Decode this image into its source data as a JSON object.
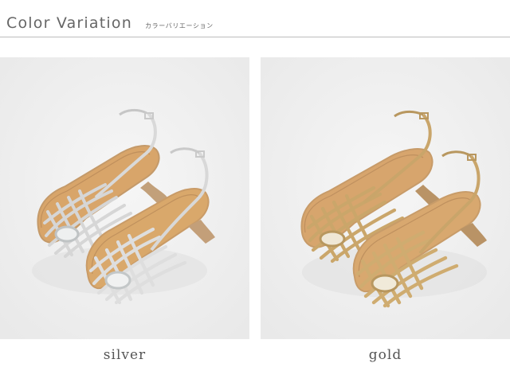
{
  "header": {
    "title": "Color Variation",
    "subtitle": "カラーバリエーション"
  },
  "variants": [
    {
      "label": "silver",
      "color": "#c9c9c9",
      "accent": "#e6e6e6",
      "insole": "#d9a66a"
    },
    {
      "label": "gold",
      "color": "#c9a86a",
      "accent": "#e8d2a2",
      "insole": "#d6a56c"
    }
  ]
}
